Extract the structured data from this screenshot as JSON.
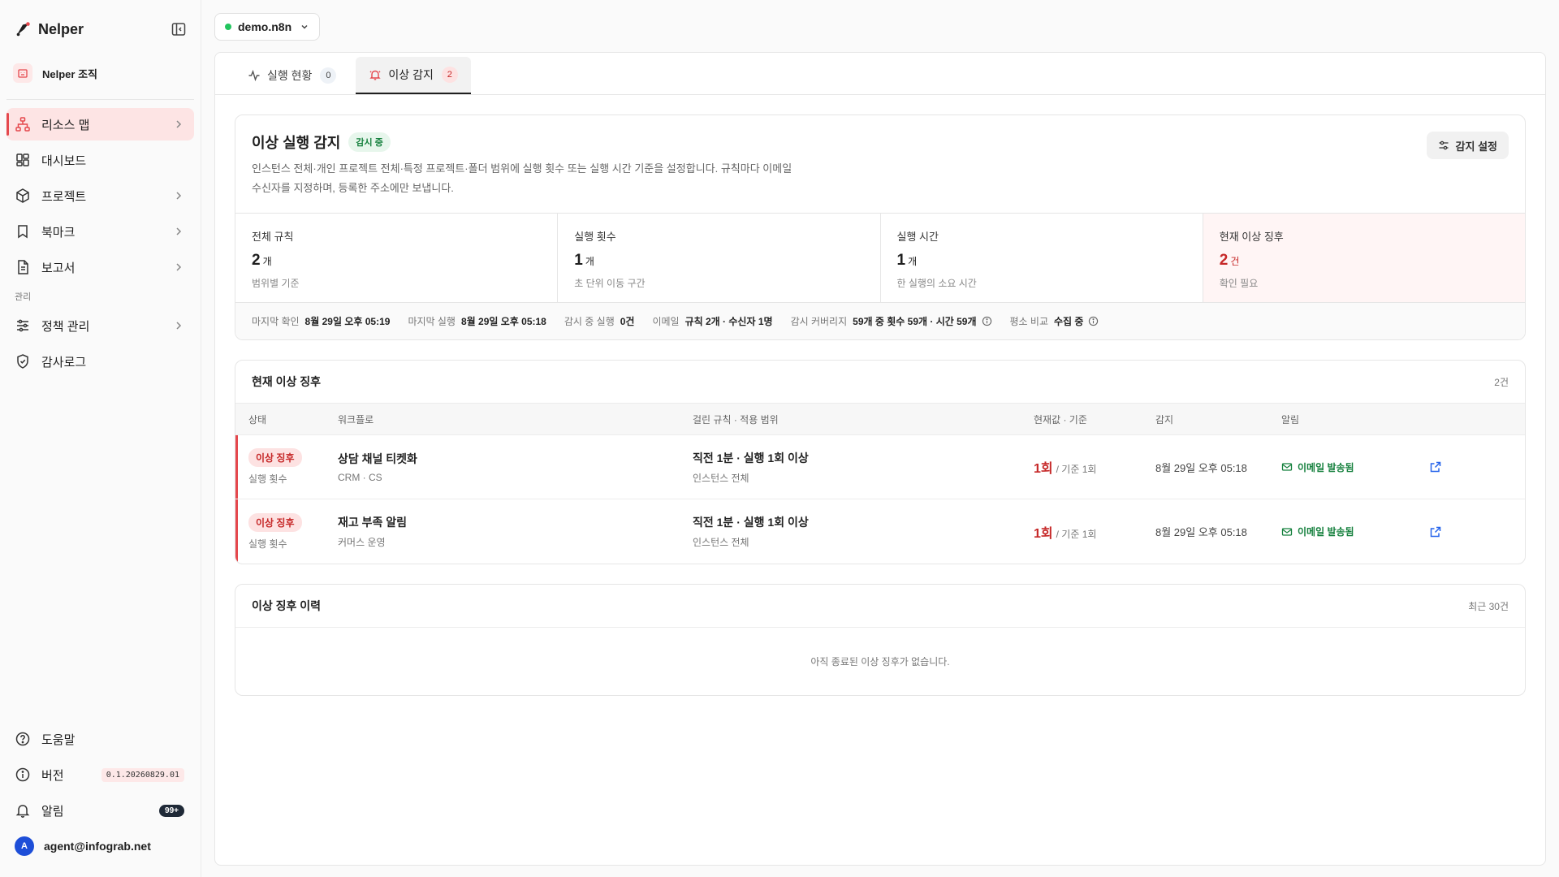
{
  "brand": {
    "name": "Nelper"
  },
  "org": {
    "label": "Nelper 조직"
  },
  "nav": {
    "items": [
      {
        "label": "리소스 맵"
      },
      {
        "label": "대시보드"
      },
      {
        "label": "프로젝트"
      },
      {
        "label": "북마크"
      },
      {
        "label": "보고서"
      }
    ],
    "section_admin": "관리",
    "admin_items": [
      {
        "label": "정책 관리"
      },
      {
        "label": "감사로그"
      }
    ],
    "bottom": {
      "help": "도움말",
      "version_label": "버전",
      "version_value": "0.1.20260829.01",
      "notifications": "알림",
      "notif_count": "99+",
      "user_initial": "A",
      "user_email": "agent@infograb.net"
    }
  },
  "instance": {
    "name": "demo.n8n"
  },
  "tabs": [
    {
      "label": "실행 현황",
      "count": "0"
    },
    {
      "label": "이상 감지",
      "count": "2"
    }
  ],
  "detect": {
    "title": "이상 실행 감지",
    "status_badge": "감시 중",
    "desc_line1": "인스턴스 전체·개인 프로젝트 전체·특정 프로젝트·폴더 범위에 실행 횟수 또는 실행 시간 기준을 설정합니다. 규칙마다 이메일",
    "desc_line2": "수신자를 지정하며, 등록한 주소에만 보냅니다.",
    "settings_button": "감지 설정",
    "stats": [
      {
        "label": "전체 규칙",
        "value": "2",
        "unit": "개",
        "sub": "범위별 기준"
      },
      {
        "label": "실행 횟수",
        "value": "1",
        "unit": "개",
        "sub": "초 단위 이동 구간"
      },
      {
        "label": "실행 시간",
        "value": "1",
        "unit": "개",
        "sub": "한 실행의 소요 시간"
      },
      {
        "label": "현재 이상 징후",
        "value": "2",
        "unit": "건",
        "sub": "확인 필요"
      }
    ],
    "meta": [
      {
        "k": "마지막 확인",
        "v": "8월 29일 오후 05:19"
      },
      {
        "k": "마지막 실행",
        "v": "8월 29일 오후 05:18"
      },
      {
        "k": "감시 중 실행",
        "v": "0건"
      },
      {
        "k": "이메일",
        "v": "규칙 2개 · 수신자 1명"
      },
      {
        "k": "감시 커버리지",
        "v": "59개 중 횟수 59개 · 시간 59개"
      },
      {
        "k": "평소 비교",
        "v": "수집 중"
      }
    ]
  },
  "current": {
    "title": "현재 이상 징후",
    "count": "2건",
    "columns": {
      "state": "상태",
      "workflow": "워크플로",
      "rule": "걸린 규칙 · 적용 범위",
      "value": "현재값 · 기준",
      "detected": "감지",
      "alert": "알림"
    },
    "rows": [
      {
        "state": "이상 징후",
        "state_sub": "실행 횟수",
        "wf": "상담 채널 티켓화",
        "wf_sub": "CRM · CS",
        "rule": "직전 1분 · 실행 1회 이상",
        "scope": "인스턴스 전체",
        "value": "1회",
        "base": "/ 기준 1회",
        "detected": "8월 29일 오후 05:18",
        "alert": "이메일 발송됨"
      },
      {
        "state": "이상 징후",
        "state_sub": "실행 횟수",
        "wf": "재고 부족 알림",
        "wf_sub": "커머스 운영",
        "rule": "직전 1분 · 실행 1회 이상",
        "scope": "인스턴스 전체",
        "value": "1회",
        "base": "/ 기준 1회",
        "detected": "8월 29일 오후 05:18",
        "alert": "이메일 발송됨"
      }
    ]
  },
  "history": {
    "title": "이상 징후 이력",
    "range": "최근 30건",
    "empty": "아직 종료된 이상 징후가 없습니다."
  },
  "colors": {
    "accent_red": "#e5484d",
    "status_green": "#15803d",
    "link_blue": "#2563eb"
  }
}
